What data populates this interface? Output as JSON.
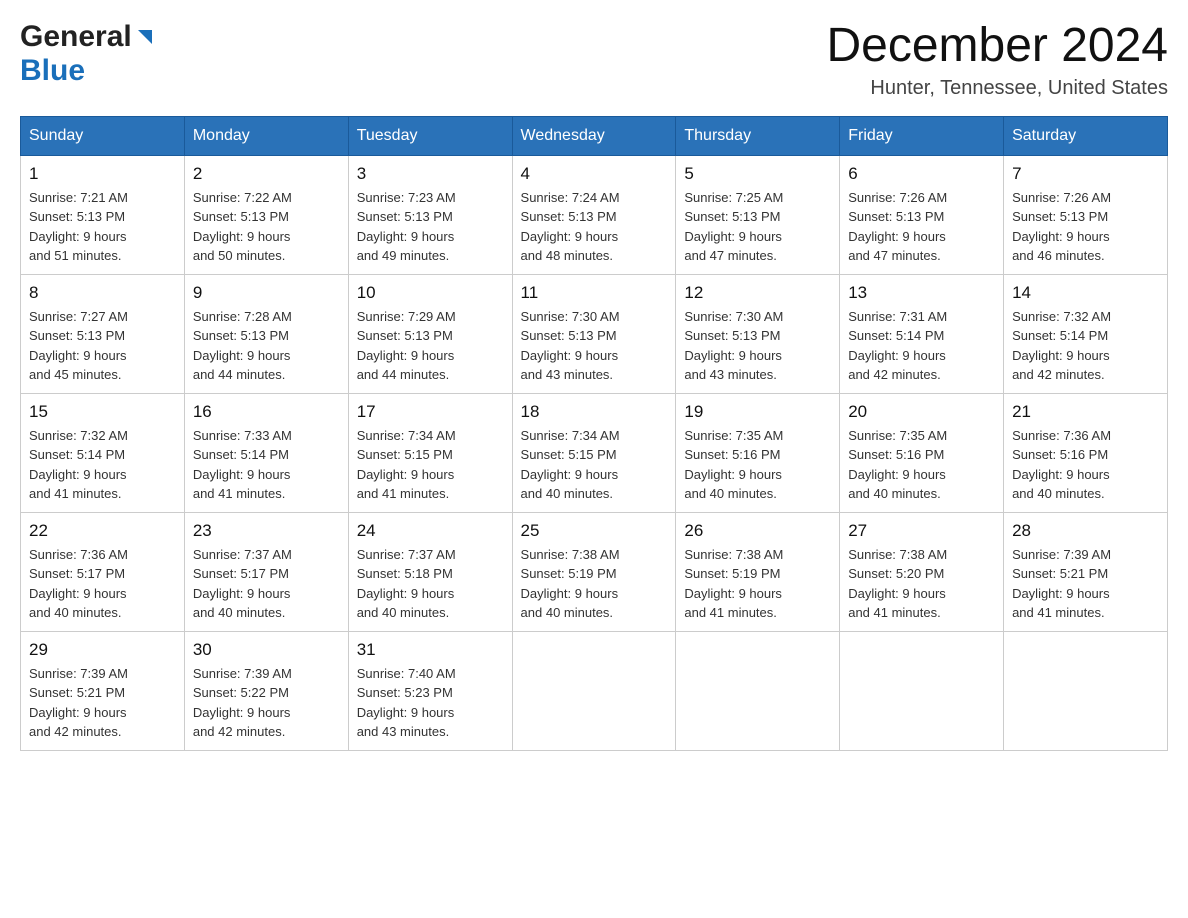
{
  "header": {
    "logo": {
      "general": "General",
      "blue": "Blue"
    },
    "title": "December 2024",
    "location": "Hunter, Tennessee, United States"
  },
  "calendar": {
    "days_of_week": [
      "Sunday",
      "Monday",
      "Tuesday",
      "Wednesday",
      "Thursday",
      "Friday",
      "Saturday"
    ],
    "weeks": [
      [
        {
          "day": "1",
          "sunrise": "7:21 AM",
          "sunset": "5:13 PM",
          "daylight": "9 hours and 51 minutes."
        },
        {
          "day": "2",
          "sunrise": "7:22 AM",
          "sunset": "5:13 PM",
          "daylight": "9 hours and 50 minutes."
        },
        {
          "day": "3",
          "sunrise": "7:23 AM",
          "sunset": "5:13 PM",
          "daylight": "9 hours and 49 minutes."
        },
        {
          "day": "4",
          "sunrise": "7:24 AM",
          "sunset": "5:13 PM",
          "daylight": "9 hours and 48 minutes."
        },
        {
          "day": "5",
          "sunrise": "7:25 AM",
          "sunset": "5:13 PM",
          "daylight": "9 hours and 47 minutes."
        },
        {
          "day": "6",
          "sunrise": "7:26 AM",
          "sunset": "5:13 PM",
          "daylight": "9 hours and 47 minutes."
        },
        {
          "day": "7",
          "sunrise": "7:26 AM",
          "sunset": "5:13 PM",
          "daylight": "9 hours and 46 minutes."
        }
      ],
      [
        {
          "day": "8",
          "sunrise": "7:27 AM",
          "sunset": "5:13 PM",
          "daylight": "9 hours and 45 minutes."
        },
        {
          "day": "9",
          "sunrise": "7:28 AM",
          "sunset": "5:13 PM",
          "daylight": "9 hours and 44 minutes."
        },
        {
          "day": "10",
          "sunrise": "7:29 AM",
          "sunset": "5:13 PM",
          "daylight": "9 hours and 44 minutes."
        },
        {
          "day": "11",
          "sunrise": "7:30 AM",
          "sunset": "5:13 PM",
          "daylight": "9 hours and 43 minutes."
        },
        {
          "day": "12",
          "sunrise": "7:30 AM",
          "sunset": "5:13 PM",
          "daylight": "9 hours and 43 minutes."
        },
        {
          "day": "13",
          "sunrise": "7:31 AM",
          "sunset": "5:14 PM",
          "daylight": "9 hours and 42 minutes."
        },
        {
          "day": "14",
          "sunrise": "7:32 AM",
          "sunset": "5:14 PM",
          "daylight": "9 hours and 42 minutes."
        }
      ],
      [
        {
          "day": "15",
          "sunrise": "7:32 AM",
          "sunset": "5:14 PM",
          "daylight": "9 hours and 41 minutes."
        },
        {
          "day": "16",
          "sunrise": "7:33 AM",
          "sunset": "5:14 PM",
          "daylight": "9 hours and 41 minutes."
        },
        {
          "day": "17",
          "sunrise": "7:34 AM",
          "sunset": "5:15 PM",
          "daylight": "9 hours and 41 minutes."
        },
        {
          "day": "18",
          "sunrise": "7:34 AM",
          "sunset": "5:15 PM",
          "daylight": "9 hours and 40 minutes."
        },
        {
          "day": "19",
          "sunrise": "7:35 AM",
          "sunset": "5:16 PM",
          "daylight": "9 hours and 40 minutes."
        },
        {
          "day": "20",
          "sunrise": "7:35 AM",
          "sunset": "5:16 PM",
          "daylight": "9 hours and 40 minutes."
        },
        {
          "day": "21",
          "sunrise": "7:36 AM",
          "sunset": "5:16 PM",
          "daylight": "9 hours and 40 minutes."
        }
      ],
      [
        {
          "day": "22",
          "sunrise": "7:36 AM",
          "sunset": "5:17 PM",
          "daylight": "9 hours and 40 minutes."
        },
        {
          "day": "23",
          "sunrise": "7:37 AM",
          "sunset": "5:17 PM",
          "daylight": "9 hours and 40 minutes."
        },
        {
          "day": "24",
          "sunrise": "7:37 AM",
          "sunset": "5:18 PM",
          "daylight": "9 hours and 40 minutes."
        },
        {
          "day": "25",
          "sunrise": "7:38 AM",
          "sunset": "5:19 PM",
          "daylight": "9 hours and 40 minutes."
        },
        {
          "day": "26",
          "sunrise": "7:38 AM",
          "sunset": "5:19 PM",
          "daylight": "9 hours and 41 minutes."
        },
        {
          "day": "27",
          "sunrise": "7:38 AM",
          "sunset": "5:20 PM",
          "daylight": "9 hours and 41 minutes."
        },
        {
          "day": "28",
          "sunrise": "7:39 AM",
          "sunset": "5:21 PM",
          "daylight": "9 hours and 41 minutes."
        }
      ],
      [
        {
          "day": "29",
          "sunrise": "7:39 AM",
          "sunset": "5:21 PM",
          "daylight": "9 hours and 42 minutes."
        },
        {
          "day": "30",
          "sunrise": "7:39 AM",
          "sunset": "5:22 PM",
          "daylight": "9 hours and 42 minutes."
        },
        {
          "day": "31",
          "sunrise": "7:40 AM",
          "sunset": "5:23 PM",
          "daylight": "9 hours and 43 minutes."
        },
        null,
        null,
        null,
        null
      ]
    ]
  }
}
